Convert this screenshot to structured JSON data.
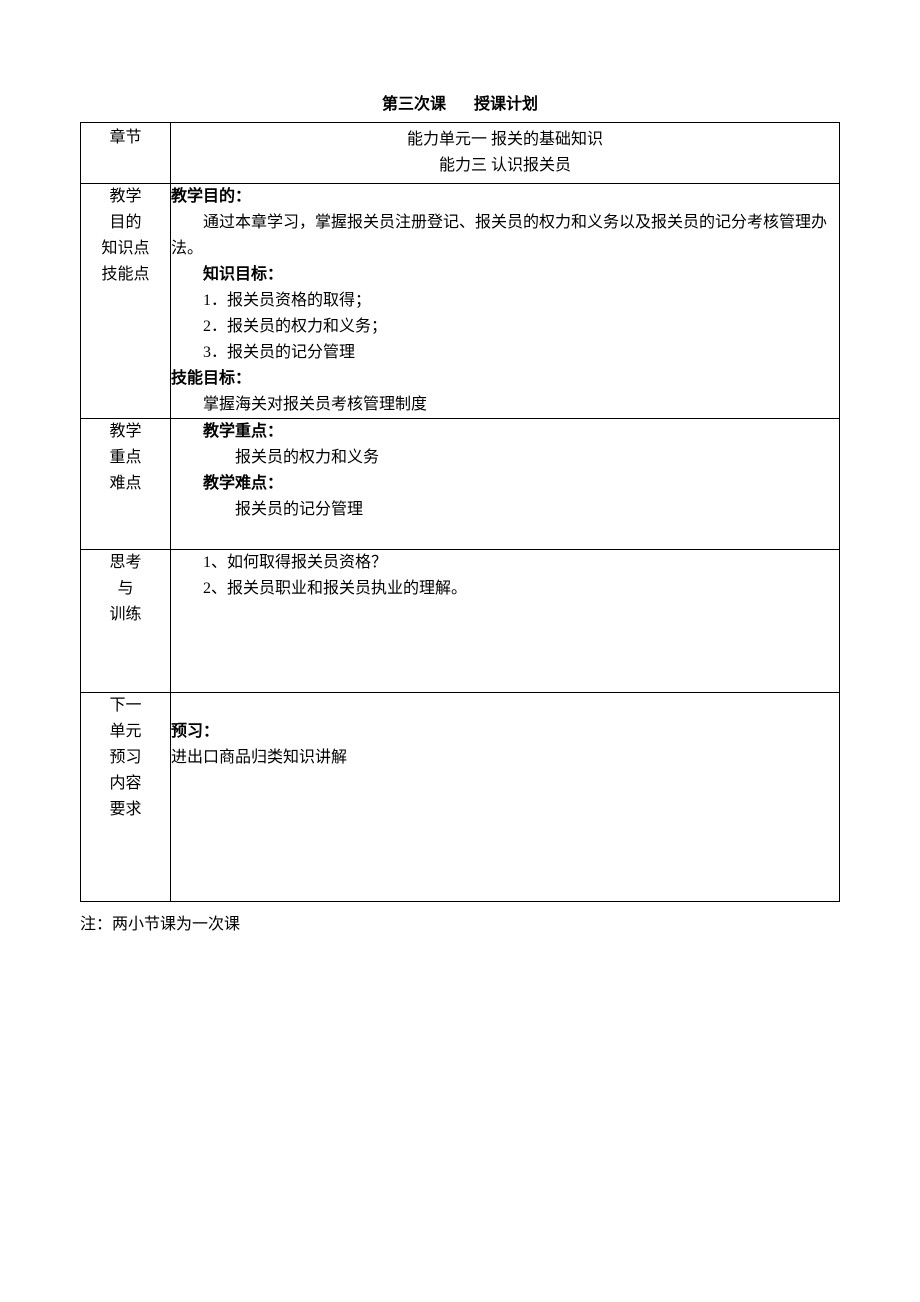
{
  "title": {
    "part1": "第三次课",
    "part2": "授课计划"
  },
  "rows": {
    "chapter": {
      "label": "章节",
      "line1": "能力单元一  报关的基础知识",
      "line2": "能力三  认识报关员"
    },
    "objectives": {
      "label_chars": [
        "教学",
        "目的",
        "知识点",
        "技能点"
      ],
      "h_purpose": "教学目的：",
      "purpose_text": "通过本章学习，掌握报关员注册登记、报关员的权力和义务以及报关员的记分考核管理办法。",
      "h_knowledge": "知识目标：",
      "k1": "1．报关员资格的取得；",
      "k2": "2．报关员的权力和义务；",
      "k3": "3．报关员的记分管理",
      "h_skill": "技能目标：",
      "skill_text": "掌握海关对报关员考核管理制度"
    },
    "focus": {
      "label_chars": [
        "教学",
        "重点",
        "难点"
      ],
      "h_focus": "教学重点：",
      "focus_text": "报关员的权力和义务",
      "h_difficulty": "教学难点：",
      "difficulty_text": "报关员的记分管理"
    },
    "thinking": {
      "label_chars": [
        "思考",
        "与",
        "训练"
      ],
      "q1": "1、如何取得报关员资格？",
      "q2": "2、报关员职业和报关员执业的理解。"
    },
    "preview": {
      "label_chars": [
        "下一",
        "单元",
        "预习",
        "内容",
        "要求"
      ],
      "h_preview": "预习：",
      "preview_text": "进出口商品归类知识讲解"
    }
  },
  "note": "注：两小节课为一次课"
}
